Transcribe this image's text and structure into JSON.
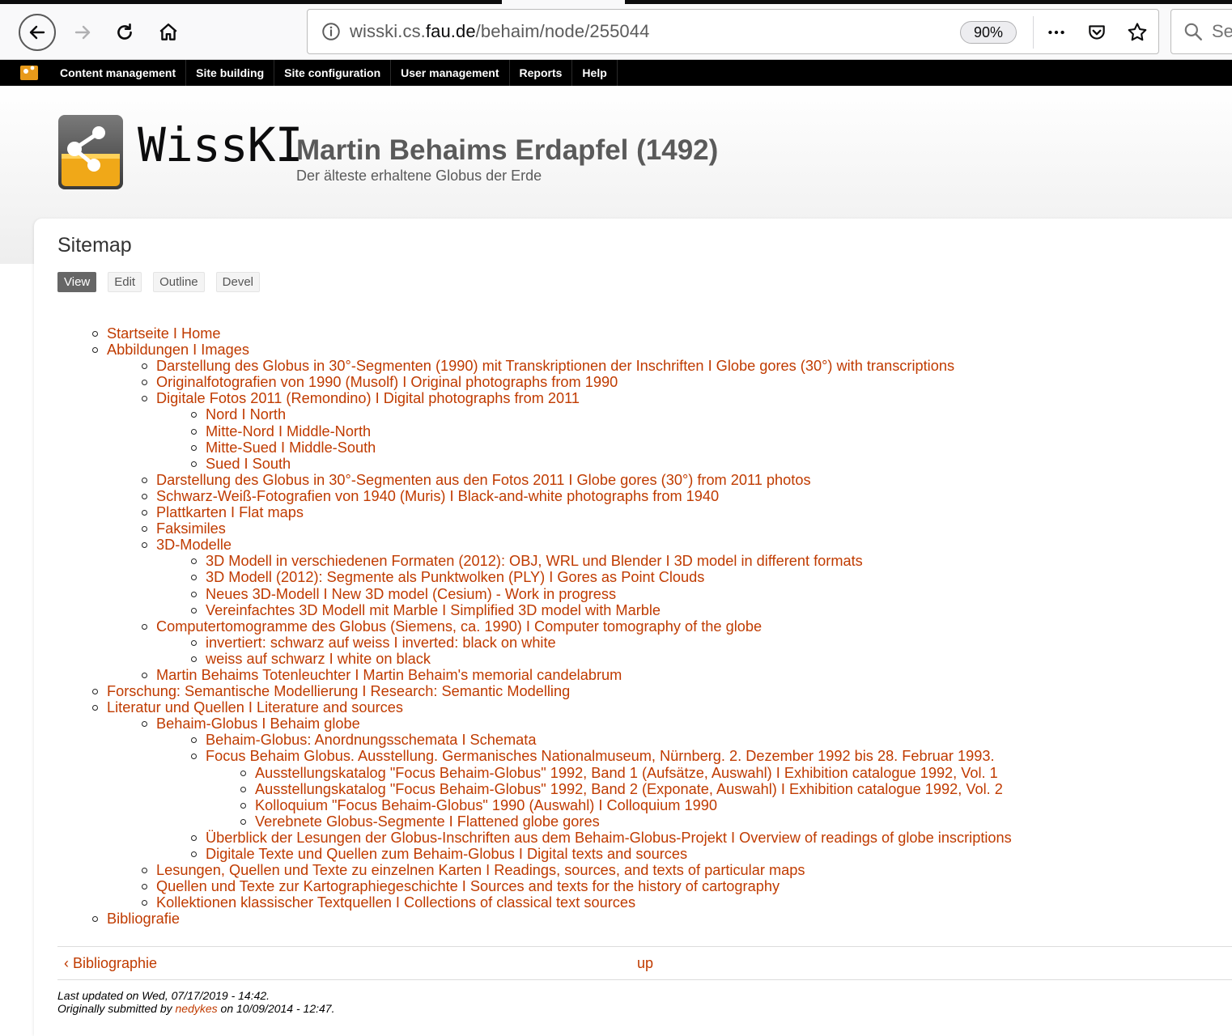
{
  "browser": {
    "url_prefix": "wisski.cs.",
    "url_domain": "fau.de",
    "url_path": "/behaim/node/255044",
    "zoom": "90%",
    "search_placeholder": "Se"
  },
  "admin_toolbar": {
    "items": [
      "Content management",
      "Site building",
      "Site configuration",
      "User management",
      "Reports",
      "Help"
    ]
  },
  "site": {
    "wordmark": "WissKI",
    "name": "Martin Behaims Erdapfel (1492)",
    "slogan": "Der älteste erhaltene Globus der Erde"
  },
  "page": {
    "title": "Sitemap",
    "tabs": [
      "View",
      "Edit",
      "Outline",
      "Devel"
    ],
    "active_tab": "View"
  },
  "sitemap": {
    "items": [
      {
        "label": "Startseite  I  Home",
        "children": []
      },
      {
        "label": "Abbildungen  I  Images",
        "children": [
          {
            "label": "Darstellung des Globus in 30°-Segmenten (1990) mit Transkriptionen der Inschriften  I  Globe gores (30°) with transcriptions",
            "children": []
          },
          {
            "label": "Originalfotografien von 1990 (Musolf)  I  Original photographs from 1990",
            "children": []
          },
          {
            "label": "Digitale Fotos 2011 (Remondino)  I  Digital photographs from 2011",
            "children": [
              {
                "label": "Nord  I  North",
                "children": []
              },
              {
                "label": "Mitte-Nord  I  Middle-North",
                "children": []
              },
              {
                "label": "Mitte-Sued  I  Middle-South",
                "children": []
              },
              {
                "label": "Sued  I  South",
                "children": []
              }
            ]
          },
          {
            "label": "Darstellung des Globus in 30°-Segmenten aus den Fotos 2011 I  Globe gores (30°) from 2011 photos",
            "children": []
          },
          {
            "label": "Schwarz-Weiß-Fotografien von 1940 (Muris)  I  Black-and-white photographs from 1940",
            "children": []
          },
          {
            "label": "Plattkarten  I  Flat maps",
            "children": []
          },
          {
            "label": "Faksimiles",
            "children": []
          },
          {
            "label": "3D-Modelle",
            "children": [
              {
                "label": "3D Modell in verschiedenen Formaten (2012): OBJ, WRL und Blender  I  3D model in different formats",
                "children": []
              },
              {
                "label": "3D Modell (2012): Segmente als Punktwolken (PLY)  I  Gores as Point Clouds",
                "children": []
              },
              {
                "label": "Neues 3D-Modell   I   New 3D model (Cesium) - Work in progress",
                "children": []
              },
              {
                "label": "Vereinfachtes 3D Modell mit Marble  I  Simplified 3D model with Marble",
                "children": []
              }
            ]
          },
          {
            "label": "Computertomogramme des Globus (Siemens, ca. 1990)  I  Computer tomography of the globe",
            "children": [
              {
                "label": "invertiert: schwarz auf weiss  I  inverted: black on white",
                "children": []
              },
              {
                "label": "weiss auf schwarz  I  white on black",
                "children": []
              }
            ]
          },
          {
            "label": "Martin Behaims Totenleuchter  I  Martin Behaim's memorial candelabrum",
            "children": []
          }
        ]
      },
      {
        "label": "Forschung: Semantische Modellierung   I   Research: Semantic Modelling",
        "children": []
      },
      {
        "label": "Literatur und Quellen  I  Literature and sources",
        "children": [
          {
            "label": "Behaim-Globus  I  Behaim globe",
            "children": [
              {
                "label": "Behaim-Globus: Anordnungsschemata  I  Schemata",
                "children": []
              },
              {
                "label": "Focus Behaim Globus. Ausstellung. Germanisches Nationalmuseum, Nürnberg. 2. Dezember 1992 bis 28. Februar 1993.",
                "children": [
                  {
                    "label": "Ausstellungskatalog \"Focus Behaim-Globus\" 1992, Band 1 (Aufsätze, Auswahl)  I  Exhibition catalogue 1992, Vol. 1",
                    "children": []
                  },
                  {
                    "label": "Ausstellungskatalog \"Focus Behaim-Globus\" 1992, Band 2 (Exponate, Auswahl)  I  Exhibition catalogue 1992, Vol. 2",
                    "children": []
                  },
                  {
                    "label": "Kolloquium \"Focus Behaim-Globus\" 1990 (Auswahl)  I  Colloquium 1990",
                    "children": []
                  },
                  {
                    "label": "Verebnete Globus-Segmente  I  Flattened globe gores",
                    "children": []
                  }
                ]
              },
              {
                "label": "Überblick der Lesungen der Globus-Inschriften aus dem Behaim-Globus-Projekt  I  Overview of readings of globe inscriptions",
                "children": []
              },
              {
                "label": "Digitale Texte und Quellen zum Behaim-Globus I  Digital texts and sources",
                "children": []
              }
            ]
          },
          {
            "label": "Lesungen, Quellen und Texte zu einzelnen Karten  I  Readings, sources, and texts of particular maps",
            "children": []
          },
          {
            "label": "Quellen und Texte zur Kartographiegeschichte  I  Sources and texts for the history of cartography",
            "children": []
          },
          {
            "label": "Kollektionen klassischer Textquellen  I  Collections of classical text sources",
            "children": []
          }
        ]
      },
      {
        "label": "Bibliografie",
        "children": []
      }
    ]
  },
  "book_nav": {
    "prev": "‹ Bibliographie",
    "up": "up"
  },
  "submitted": {
    "line1": "Last updated on Wed, 07/17/2019 - 14:42.",
    "line2_prefix": "Originally submitted by ",
    "author": "nedykes",
    "line2_suffix": " on 10/09/2014 - 12:47."
  },
  "colors": {
    "link": "#c03b00",
    "admin_bar": "#000000",
    "active_tab": "#666666"
  }
}
